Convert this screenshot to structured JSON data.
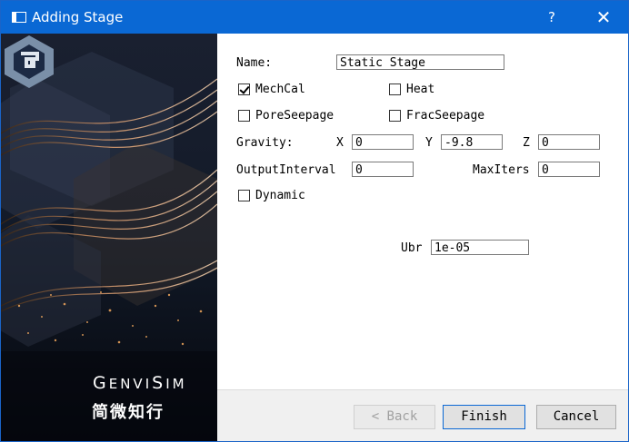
{
  "window": {
    "title": "Adding Stage",
    "help": "?",
    "close": "✕"
  },
  "branding": {
    "logo_en_prefix": "G",
    "logo_en_rest1": "ENVI",
    "logo_en_s": "S",
    "logo_en_rest2": "IM",
    "logo_cn": "简微知行"
  },
  "form": {
    "name_label": "Name:",
    "name_value": "Static Stage",
    "mechcal_label": "MechCal",
    "mechcal_checked": true,
    "heat_label": "Heat",
    "heat_checked": false,
    "poreseepage_label": "PoreSeepage",
    "poreseepage_checked": false,
    "fracseepage_label": "FracSeepage",
    "fracseepage_checked": false,
    "gravity_label": "Gravity:",
    "gx_label": "X",
    "gx_value": "0",
    "gy_label": "Y",
    "gy_value": "-9.8",
    "gz_label": "Z",
    "gz_value": "0",
    "output_label": "OutputInterval",
    "output_value": "0",
    "maxiters_label": "MaxIters",
    "maxiters_value": "0",
    "dynamic_label": "Dynamic",
    "dynamic_checked": false,
    "ubr_label": "Ubr",
    "ubr_value": "1e-05"
  },
  "buttons": {
    "back": "< Back",
    "finish": "Finish",
    "cancel": "Cancel"
  }
}
